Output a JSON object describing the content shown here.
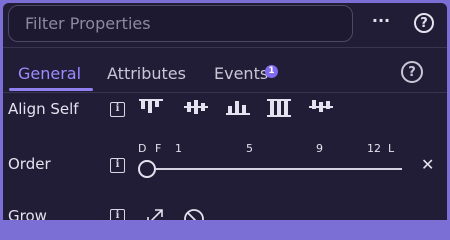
{
  "filter": {
    "placeholder": "Filter Properties"
  },
  "toolbar": {
    "more_label": "···",
    "help_label": "?"
  },
  "tabs": [
    {
      "label": "General",
      "active": true
    },
    {
      "label": "Attributes",
      "active": false
    },
    {
      "label": "Events",
      "active": false,
      "badge": "1"
    }
  ],
  "tabs_help_label": "?",
  "properties": {
    "align_self": {
      "label": "Align Self",
      "info": "i",
      "options": [
        "align-start-icon",
        "align-center-icon",
        "align-end-icon",
        "align-stretch-icon",
        "align-baseline-icon"
      ]
    },
    "order": {
      "label": "Order",
      "info": "i",
      "ticks": [
        "D",
        "F",
        "1",
        "5",
        "9",
        "12",
        "L"
      ],
      "value": "D",
      "clear_label": "✕"
    },
    "grow": {
      "label": "Grow",
      "info": "i",
      "options": [
        "grow-icon",
        "no-grow-icon"
      ]
    }
  },
  "colors": {
    "accent": "#9b8cff",
    "panel_bg": "#221d36",
    "frame": "#7b6fd6",
    "badge": "#7e6bf0"
  }
}
